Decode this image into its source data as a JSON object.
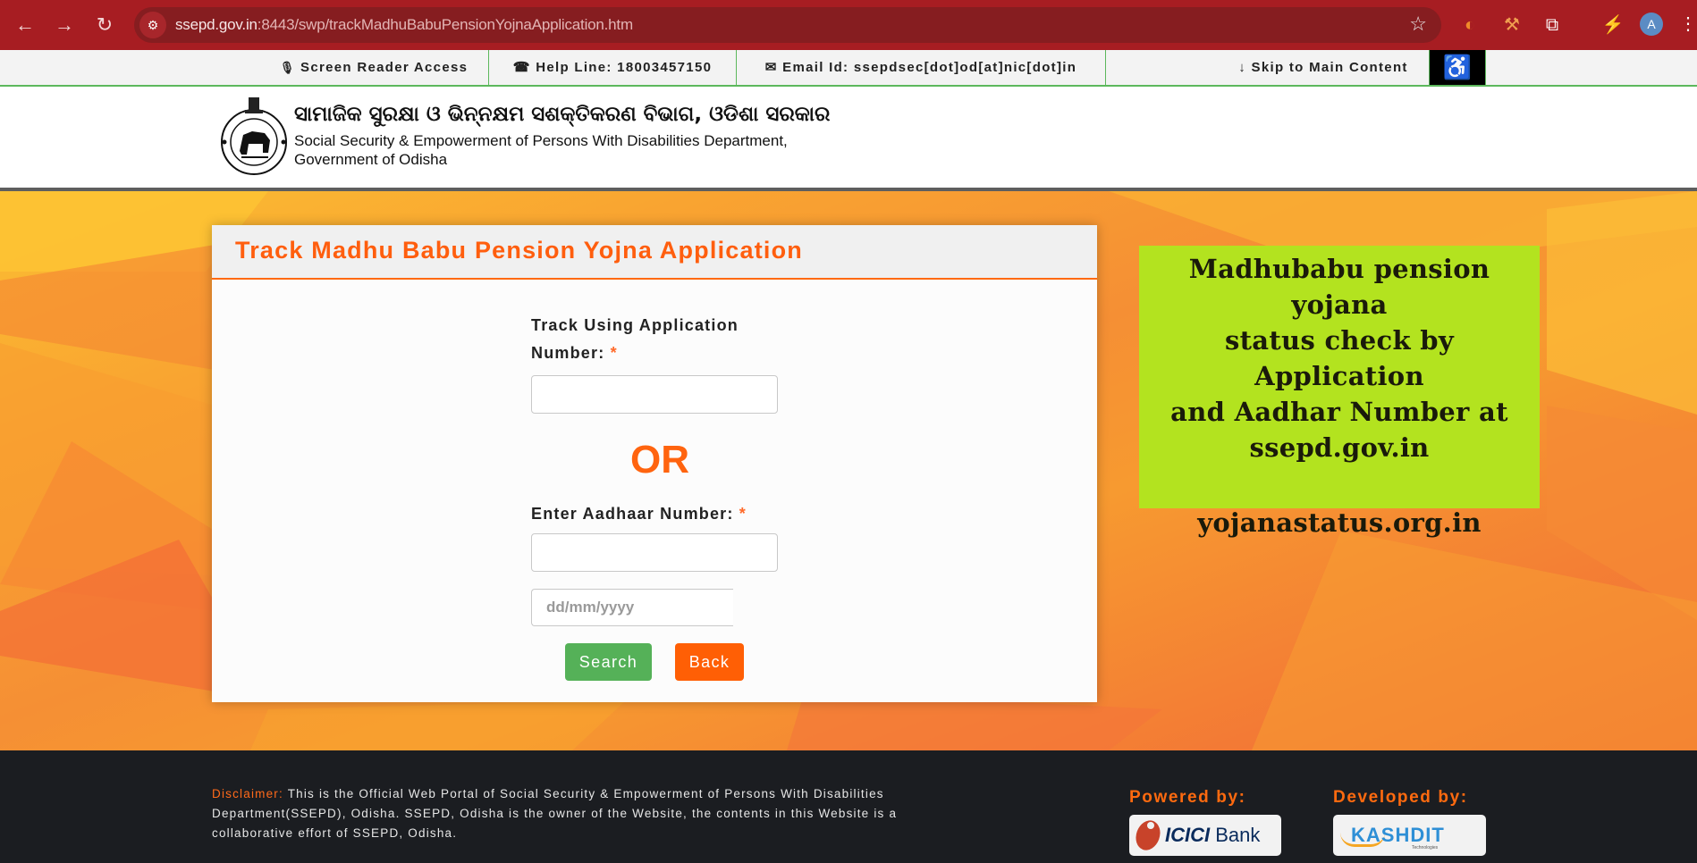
{
  "browser": {
    "url_host": "ssepd.gov.in",
    "url_path": ":8443/swp/trackMadhuBabuPensionYojnaApplication.htm",
    "back_icon": "←",
    "forward_icon": "→",
    "reload_icon": "↻",
    "site_info_icon": "⚙",
    "star_icon": "☆",
    "avatar_letter": "A",
    "menu_icon": "⋮",
    "extensions": [
      "◐",
      "⚒",
      "⧉",
      "⚡"
    ]
  },
  "top_strip": {
    "screen_reader": "Screen Reader Access",
    "helpline": "Help Line: 18003457150",
    "email": "Email Id: ssepdsec[dot]od[at]nic[dot]in",
    "skip": "Skip to Main Content",
    "mic_icon": "🎙",
    "phone_icon": "☎",
    "mail_icon": "✉",
    "skip_icon": "↓",
    "accessibility_icon": "♿"
  },
  "header": {
    "odia_title": "ସାମାଜିକ ସୁରକ୍ଷା ଓ ଭିନ୍ନକ୍ଷମ ସଶକ୍ତିକରଣ ବିଭାଗ, ଓଡିଶା ସରକାର",
    "dept_line1": "Social Security & Empowerment of Persons With Disabilities Department,",
    "dept_line2": "Government of Odisha"
  },
  "form": {
    "title": "Track Madhu Babu Pension Yojna Application",
    "app_label_line1": "Track Using Application",
    "app_label_line2": "Number:",
    "required_mark": "*",
    "app_number_value": "",
    "or_text": "OR",
    "aadhaar_label": "Enter Aadhaar Number:",
    "aadhaar_value": "",
    "date_placeholder": "dd/mm/yyyy",
    "search_button": "Search",
    "back_button": "Back"
  },
  "promo": {
    "lines": [
      "Madhubabu pension yojana",
      "status check  by Application",
      "and Aadhar Number at",
      "ssepd.gov.in"
    ],
    "site": "yojanastatus.org.in"
  },
  "footer": {
    "disclaimer_label": "Disclaimer:",
    "disclaimer_text": "This is the Official Web Portal of Social Security & Empowerment of Persons With Disabilities Department(SSEPD), Odisha. SSEPD, Odisha is the owner of the Website, the contents in this Website is a collaborative effort of SSEPD, Odisha.",
    "powered_by": "Powered by:",
    "developed_by": "Developed by:",
    "icici_brand": "ICICI",
    "icici_bank": "Bank",
    "kashdit_brand": "KASHDIT",
    "kashdit_sub": "Technologies"
  },
  "colors": {
    "browser_red": "#a71d22",
    "accent_orange": "#ff5e0e",
    "strip_green": "#5cb85c",
    "search_green": "#55b158",
    "promo_green": "#b3e31f",
    "footer_dark": "#1b1d21"
  }
}
